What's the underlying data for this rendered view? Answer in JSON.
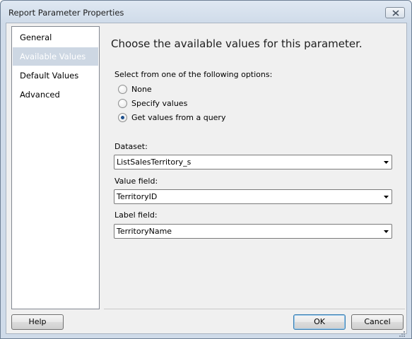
{
  "window": {
    "title": "Report Parameter Properties"
  },
  "nav": {
    "items": [
      {
        "label": "General",
        "selected": false
      },
      {
        "label": "Available Values",
        "selected": true
      },
      {
        "label": "Default Values",
        "selected": false
      },
      {
        "label": "Advanced",
        "selected": false
      }
    ]
  },
  "main": {
    "heading": "Choose the available values for this parameter.",
    "options_label": "Select from one of the following options:",
    "options": [
      {
        "label": "None",
        "checked": false
      },
      {
        "label": "Specify values",
        "checked": false
      },
      {
        "label": "Get values from a query",
        "checked": true
      }
    ],
    "dataset": {
      "label": "Dataset:",
      "value": "ListSalesTerritory_s"
    },
    "value_field": {
      "label": "Value field:",
      "value": "TerritoryID"
    },
    "label_field": {
      "label": "Label field:",
      "value": "TerritoryName"
    }
  },
  "buttons": {
    "help": "Help",
    "ok": "OK",
    "cancel": "Cancel"
  },
  "icons": {
    "close": "close-icon",
    "dropdown": "chevron-down-icon",
    "resize": "resize-grip-icon"
  },
  "colors": {
    "selection": "#cdd7e3",
    "radio_dot": "#1d4f8c",
    "frame": "#cfdbe9"
  }
}
